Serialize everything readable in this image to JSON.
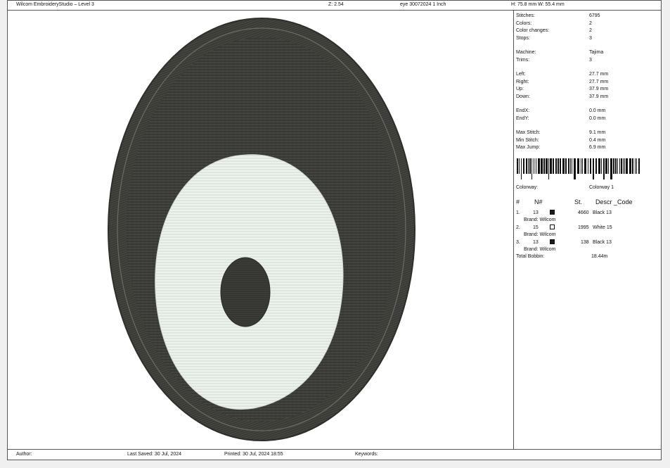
{
  "header": {
    "app_title": "Wilcom EmbroideryStudio – Level 3",
    "zoom": "Z: 2.54",
    "design_name": "eye 30072024 1 Inch",
    "size": "H: 75.8 mm  W: 55.4 mm"
  },
  "stats": [
    {
      "label": "Stitches:",
      "value": "6795"
    },
    {
      "label": "Colors:",
      "value": "2"
    },
    {
      "label": "Color changes:",
      "value": "2"
    },
    {
      "label": "Stops:",
      "value": "3"
    },
    {
      "label": "Machine:",
      "value": "Tajima"
    },
    {
      "label": "Trims:",
      "value": "3"
    },
    {
      "label": "Left:",
      "value": "27.7 mm"
    },
    {
      "label": "Right:",
      "value": "27.7 mm"
    },
    {
      "label": "Up:",
      "value": "37.9 mm"
    },
    {
      "label": "Down:",
      "value": "37.9 mm"
    },
    {
      "label": "EndX:",
      "value": "0.0 mm"
    },
    {
      "label": "EndY:",
      "value": "0.0 mm"
    },
    {
      "label": "Max Stitch:",
      "value": "9.1 mm"
    },
    {
      "label": "Min Stitch:",
      "value": "0.4 mm"
    },
    {
      "label": "Max Jump:",
      "value": "6.9 mm"
    }
  ],
  "colorway": {
    "label": "Colorway:",
    "value": "Colorway 1"
  },
  "color_table": {
    "headers": [
      "#",
      "N#",
      "St.",
      "Descr _Code"
    ],
    "rows": [
      {
        "index": "1.",
        "number": "13",
        "swatch": "#1a1a1a",
        "stitches": "4660",
        "descr": "Black 13",
        "brand": "Brand: Wilcom"
      },
      {
        "index": "2.",
        "number": "15",
        "swatch": "#ffffff",
        "stitches": "1995",
        "descr": "White 15",
        "brand": "Brand: Wilcom"
      },
      {
        "index": "3.",
        "number": "13",
        "swatch": "#1a1a1a",
        "stitches": "138",
        "descr": "Black 13",
        "brand": "Brand: Wilcom"
      }
    ],
    "total_label": "Total Bobbin:",
    "total_value": "18.44m"
  },
  "footer": {
    "author": "Author:",
    "last_saved": "Last Saved: 30 Jul, 2024",
    "printed": "Printed: 30 Jul, 2024 18:55",
    "keywords": "Keywords:"
  },
  "colors": {
    "outer_border": "#3a3b36",
    "dark_fill": "#3f403c",
    "white_fill": "#e6ede6",
    "pupil": "#3c3d39"
  }
}
